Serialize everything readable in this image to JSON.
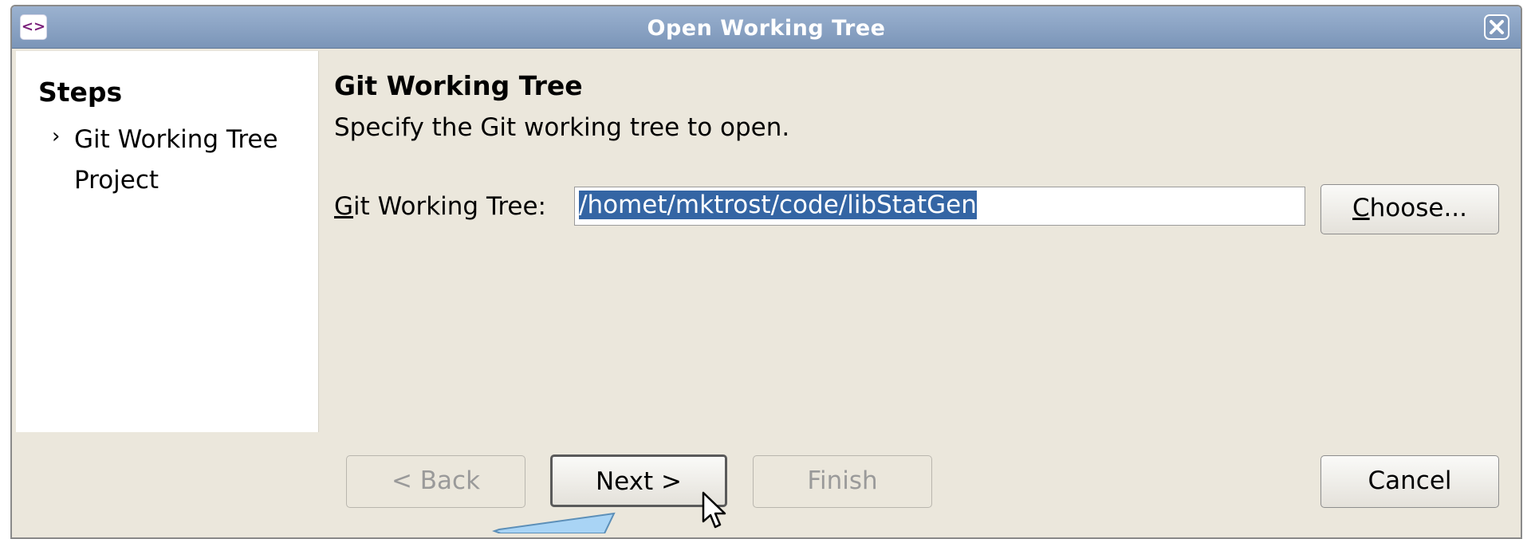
{
  "window": {
    "title": "Open Working Tree",
    "app_icon_glyph": "<>",
    "close_icon": "close-icon"
  },
  "steps": {
    "heading": "Steps",
    "marker": "›",
    "items": [
      {
        "label": "Git Working Tree Project",
        "current": true
      }
    ]
  },
  "page": {
    "title": "Git Working Tree",
    "description": "Specify the Git working tree to open.",
    "field_label_mnemonic": "G",
    "field_label_rest": "it Working Tree:",
    "field_value": "/homet/mktrost/code/libStatGen",
    "choose_mnemonic": "C",
    "choose_rest": "hoose..."
  },
  "buttons": {
    "back": "< Back",
    "next": "Next >",
    "finish": "Finish",
    "cancel": "Cancel"
  },
  "colors": {
    "dialog_background": "#ebe7dc",
    "titlebar": "#8aa3c6",
    "selection": "#3465a4",
    "annotation_arrow": "#a9d4f5"
  }
}
